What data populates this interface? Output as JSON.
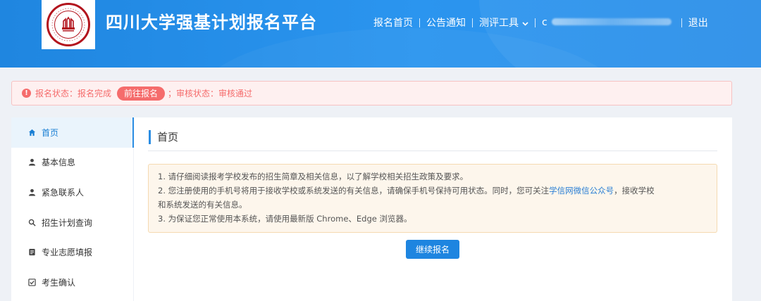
{
  "header": {
    "title": "四川大学强基计划报名平台",
    "nav": {
      "home": "报名首页",
      "notice": "公告通知",
      "tools": "测评工具",
      "user_initial": "c",
      "logout": "退出"
    }
  },
  "alert": {
    "status_label": "报名状态：报名完成",
    "button": "前往报名",
    "review": "；审核状态：审核通过"
  },
  "sidebar": {
    "items": [
      {
        "label": "首页",
        "icon": "home-icon"
      },
      {
        "label": "基本信息",
        "icon": "user-icon"
      },
      {
        "label": "紧急联系人",
        "icon": "user-icon"
      },
      {
        "label": "招生计划查询",
        "icon": "search-icon"
      },
      {
        "label": "专业志愿填报",
        "icon": "document-icon"
      },
      {
        "label": "考生确认",
        "icon": "checkbox-icon"
      }
    ]
  },
  "main": {
    "title": "首页",
    "notice": {
      "line1": "1. 请仔细阅读报考学校发布的招生简章及相关信息，以了解学校相关招生政策及要求。",
      "line2_prefix": "2. 您注册使用的手机号将用于接收学校或系统发送的有关信息，请确保手机号保持可用状态。同时，您可关注",
      "line2_link": "学信网微信公众号",
      "line2_suffix": "，接收学校",
      "line3": "和系统发送的有关信息。",
      "line4": "3. 为保证您正常使用本系统，请使用最新版 Chrome、Edge 浏览器。"
    },
    "button": "继续报名"
  },
  "colors": {
    "header_blue": "#2b95ef",
    "alert_red": "#f56c6c",
    "primary": "#1e85e0",
    "logo_red": "#b3141d"
  }
}
